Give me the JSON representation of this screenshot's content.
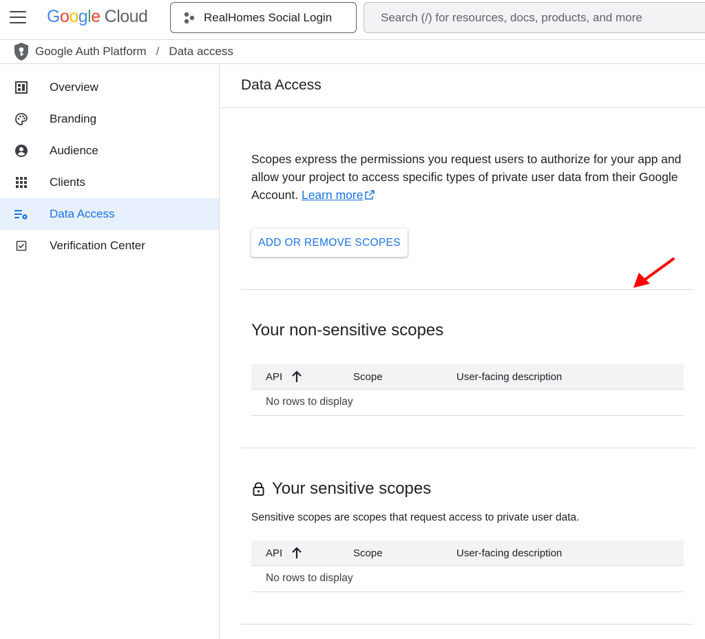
{
  "header": {
    "logo_google": "Google",
    "logo_cloud": "Cloud",
    "project_name": "RealHomes Social Login",
    "search_placeholder": "Search (/) for resources, docs, products, and more"
  },
  "breadcrumb": {
    "product": "Google Auth Platform",
    "separator": "/",
    "page": "Data access"
  },
  "sidebar": {
    "items": [
      {
        "label": "Overview",
        "icon": "dashboard-icon"
      },
      {
        "label": "Branding",
        "icon": "palette-icon"
      },
      {
        "label": "Audience",
        "icon": "account-circle-icon"
      },
      {
        "label": "Clients",
        "icon": "apps-grid-icon"
      },
      {
        "label": "Data Access",
        "icon": "data-settings-icon",
        "active": true
      },
      {
        "label": "Verification Center",
        "icon": "checkbox-icon"
      }
    ]
  },
  "main": {
    "title": "Data Access",
    "intro_text": "Scopes express the permissions you request users to authorize for your app and allow your project to access specific types of private user data from their Google Account. ",
    "learn_more": "Learn more",
    "add_scopes_button": "ADD OR REMOVE SCOPES",
    "non_sensitive": {
      "title": "Your non-sensitive scopes",
      "columns": [
        "API",
        "Scope",
        "User-facing description"
      ],
      "empty": "No rows to display"
    },
    "sensitive": {
      "title": "Your sensitive scopes",
      "description": "Sensitive scopes are scopes that request access to private user data.",
      "columns": [
        "API",
        "Scope",
        "User-facing description"
      ],
      "empty": "No rows to display"
    }
  },
  "colors": {
    "accent": "#1a73e8",
    "active_bg": "#e8f0fe",
    "annotation_arrow": "#ff0000"
  }
}
